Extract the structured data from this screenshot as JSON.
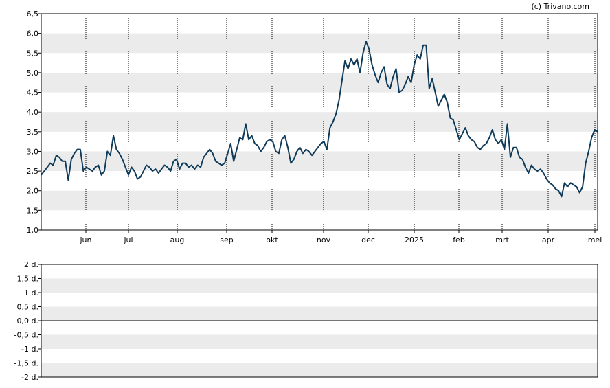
{
  "copyright": "(c) Trivano.com",
  "colors": {
    "line": "#0f3b5a",
    "band": "#ebebeb",
    "grid": "#000000",
    "axis": "#000000",
    "background": "#ffffff"
  },
  "chart_data": [
    {
      "type": "line",
      "ylim": [
        1.0,
        6.5
      ],
      "yticks": [
        "1,0",
        "1,5",
        "2,0",
        "2,5",
        "3,0",
        "3,5",
        "4,0",
        "4,5",
        "5,0",
        "5,5",
        "6,0",
        "6,5"
      ],
      "xticks": [
        "jun",
        "jul",
        "aug",
        "sep",
        "okt",
        "nov",
        "dec",
        "2025",
        "feb",
        "mrt",
        "apr",
        "mei"
      ],
      "grid": "alternating horizontal bands, dotted vertical lines at month ticks",
      "series": [
        {
          "values": [
            2.4,
            2.5,
            2.6,
            2.7,
            2.65,
            2.9,
            2.85,
            2.75,
            2.75,
            2.27,
            2.8,
            2.95,
            3.05,
            3.05,
            2.5,
            2.6,
            2.55,
            2.5,
            2.6,
            2.65,
            2.4,
            2.5,
            3.0,
            2.9,
            3.4,
            3.05,
            2.95,
            2.8,
            2.6,
            2.4,
            2.6,
            2.5,
            2.3,
            2.35,
            2.5,
            2.65,
            2.6,
            2.5,
            2.55,
            2.45,
            2.55,
            2.65,
            2.6,
            2.5,
            2.75,
            2.8,
            2.55,
            2.7,
            2.7,
            2.6,
            2.65,
            2.55,
            2.65,
            2.6,
            2.85,
            2.95,
            3.05,
            2.95,
            2.75,
            2.7,
            2.65,
            2.7,
            2.95,
            3.2,
            2.75,
            3.05,
            3.35,
            3.3,
            3.7,
            3.3,
            3.4,
            3.2,
            3.15,
            3.0,
            3.1,
            3.25,
            3.3,
            3.25,
            3.0,
            2.95,
            3.3,
            3.4,
            3.1,
            2.7,
            2.8,
            3.0,
            3.1,
            2.95,
            3.05,
            3.0,
            2.9,
            3.0,
            3.1,
            3.2,
            3.25,
            3.05,
            3.6,
            3.75,
            3.95,
            4.3,
            4.8,
            5.3,
            5.1,
            5.35,
            5.2,
            5.35,
            5.0,
            5.5,
            5.8,
            5.6,
            5.2,
            4.95,
            4.75,
            5.0,
            5.15,
            4.7,
            4.6,
            4.9,
            5.1,
            4.5,
            4.55,
            4.7,
            4.9,
            4.75,
            5.2,
            5.45,
            5.35,
            5.7,
            5.7,
            4.6,
            4.85,
            4.5,
            4.15,
            4.3,
            4.45,
            4.25,
            3.85,
            3.8,
            3.55,
            3.3,
            3.45,
            3.6,
            3.4,
            3.3,
            3.25,
            3.1,
            3.05,
            3.15,
            3.2,
            3.35,
            3.55,
            3.3,
            3.2,
            3.3,
            3.05,
            3.7,
            2.85,
            3.1,
            3.1,
            2.85,
            2.8,
            2.6,
            2.45,
            2.65,
            2.55,
            2.5,
            2.55,
            2.45,
            2.3,
            2.2,
            2.15,
            2.05,
            2.0,
            1.85,
            2.2,
            2.1,
            2.2,
            2.15,
            2.1,
            1.95,
            2.1,
            2.7,
            3.0,
            3.35,
            3.55,
            3.5
          ]
        }
      ]
    },
    {
      "type": "bar",
      "ylim": [
        -2,
        2
      ],
      "yticks": [
        "2 d.",
        "1,5 d.",
        "1 d.",
        "0,5 d.",
        "0,0 d.",
        "-0,5 d.",
        "-1 d.",
        "-1,5 d.",
        "-2 d."
      ],
      "grid": "alternating horizontal bands",
      "series": []
    }
  ]
}
